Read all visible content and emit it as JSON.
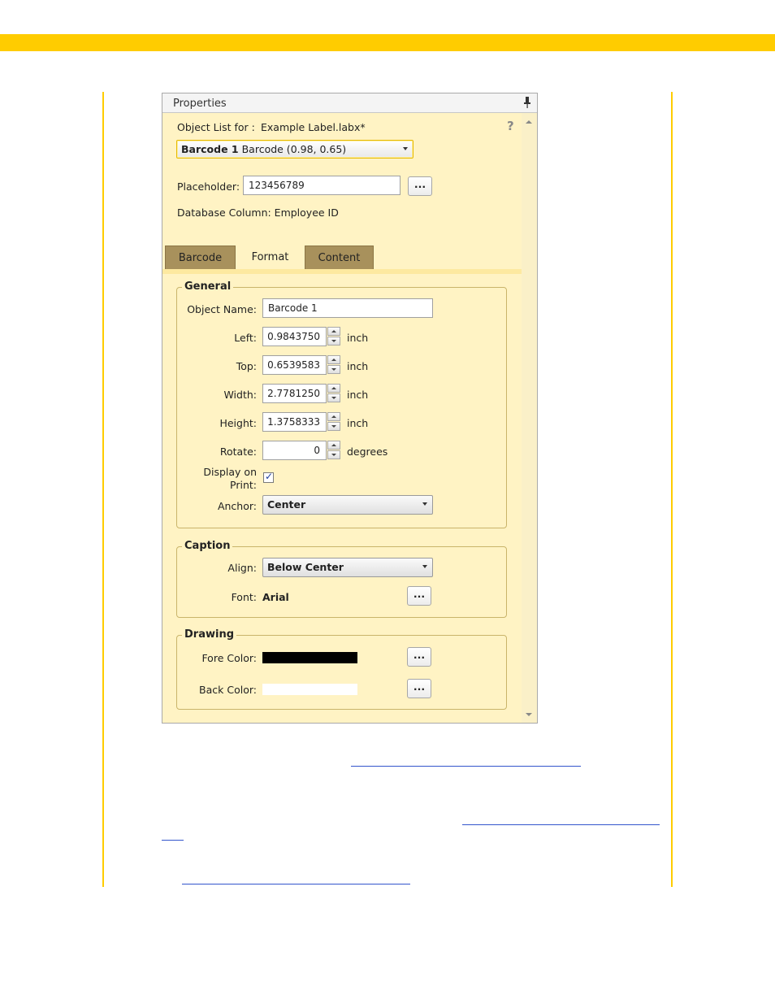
{
  "panel": {
    "title": "Properties",
    "object_list_label": "Object List for :",
    "object_list_file": "Example Label.labx*",
    "help_glyph": "?",
    "object_select": {
      "name": "Barcode 1",
      "detail": "Barcode (0.98, 0.65)"
    },
    "placeholder_label": "Placeholder:",
    "placeholder_value": "123456789",
    "ellipsis": "...",
    "db_column": "Database Column: Employee ID"
  },
  "tabs": [
    {
      "label": "Barcode",
      "active": false
    },
    {
      "label": "Format",
      "active": true
    },
    {
      "label": "Content",
      "active": false
    }
  ],
  "general": {
    "legend": "General",
    "object_name_label": "Object Name:",
    "object_name_value": "Barcode 1",
    "left_label": "Left:",
    "left_value": "0.9843750",
    "top_label": "Top:",
    "top_value": "0.6539583",
    "width_label": "Width:",
    "width_value": "2.7781250",
    "height_label": "Height:",
    "height_value": "1.3758333",
    "rotate_label": "Rotate:",
    "rotate_value": "0",
    "unit_inch": "inch",
    "unit_degrees": "degrees",
    "display_label_1": "Display on",
    "display_label_2": "Print:",
    "display_checked": true,
    "anchor_label": "Anchor:",
    "anchor_value": "Center"
  },
  "caption": {
    "legend": "Caption",
    "align_label": "Align:",
    "align_value": "Below Center",
    "font_label": "Font:",
    "font_value": "Arial"
  },
  "drawing": {
    "legend": "Drawing",
    "fore_label": "Fore Color:",
    "fore_color": "#000000",
    "back_label": "Back Color:",
    "back_color": "#ffffff"
  },
  "colors": {
    "accent": "#ffcc00",
    "panel_bg": "#fff3c4",
    "tab_inactive": "#a8915c"
  }
}
